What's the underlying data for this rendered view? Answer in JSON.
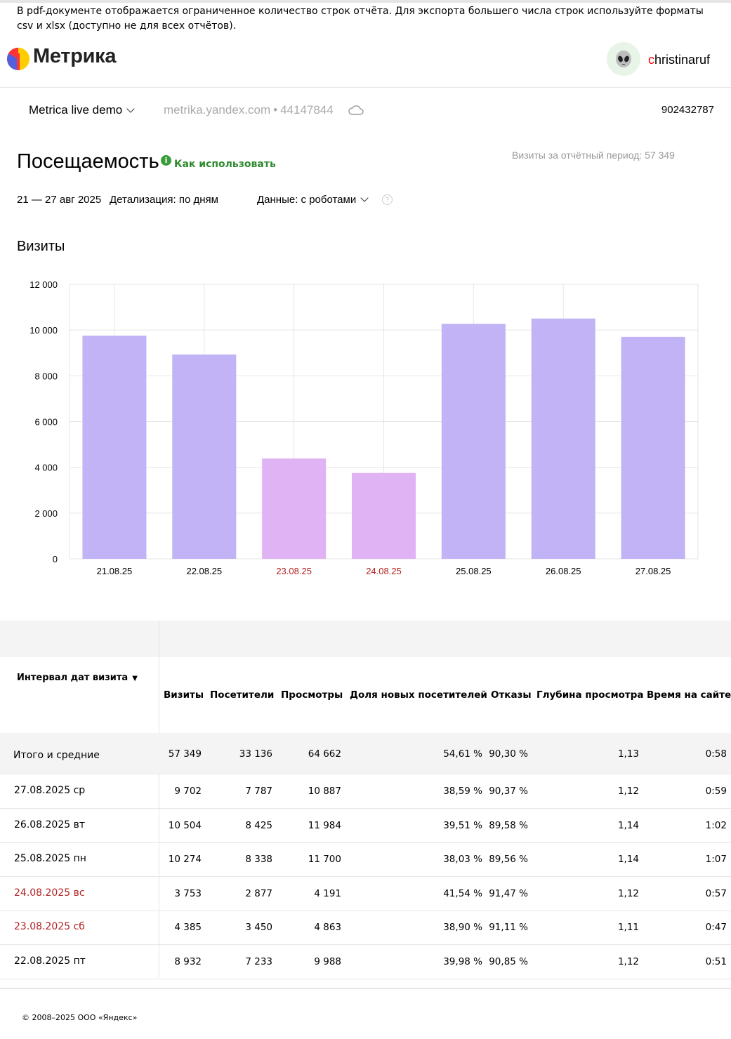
{
  "notice": "В pdf-документе отображается ограниченное количество строк отчёта. Для экспорта большего числа строк используйте форматы csv и xlsx (доступно не для всех отчётов).",
  "header": {
    "logo_text": "Метрика",
    "username_first": "c",
    "username_rest": "hristinaruf",
    "avatar_icon": "alien-icon"
  },
  "counter": {
    "name": "Metrica live demo",
    "site": "metrika.yandex.com",
    "separator": "•",
    "id": "44147844",
    "user_id": "902432787"
  },
  "report": {
    "title": "Посещаемость",
    "howto": "Как использовать",
    "visits_total": "Визиты за отчётный период: 57 349",
    "date_range": "21 — 27 авг 2025",
    "detail": "Детализация: по дням",
    "robots": "Данные: с роботами",
    "help_mark": "?"
  },
  "colors": {
    "weekday_bar": "#c1b3f5",
    "weekend_bar": "#e0b3f5",
    "weekend_text": "#b22222",
    "grid": "#e6e6e6"
  },
  "chart_data": {
    "type": "bar",
    "title": "Визиты",
    "categories": [
      "21.08.25",
      "22.08.25",
      "23.08.25",
      "24.08.25",
      "25.08.25",
      "26.08.25",
      "27.08.25"
    ],
    "values": [
      9754,
      8932,
      4385,
      3753,
      10274,
      10504,
      9702
    ],
    "weekend": [
      false,
      false,
      true,
      true,
      false,
      false,
      false
    ],
    "ylim": [
      0,
      12000
    ],
    "yticks": [
      "0",
      "2 000",
      "4 000",
      "6 000",
      "8 000",
      "10 000",
      "12 000"
    ],
    "grid": true
  },
  "table": {
    "dim_header": "Интервал дат визита",
    "sort_mark": "▼",
    "columns": [
      "Визиты",
      "Посетители",
      "Просмотры",
      "Доля новых посетителей",
      "Отказы",
      "Глубина просмотра",
      "Время на сайте"
    ],
    "total": {
      "label": "Итого и средние",
      "values": [
        "57 349",
        "33 136",
        "64 662",
        "54,61 %",
        "90,30 %",
        "1,13",
        "0:58"
      ]
    },
    "rows": [
      {
        "label": "27.08.2025 ср",
        "weekend": false,
        "values": [
          "9 702",
          "7 787",
          "10 887",
          "38,59 %",
          "90,37 %",
          "1,12",
          "0:59"
        ]
      },
      {
        "label": "26.08.2025 вт",
        "weekend": false,
        "values": [
          "10 504",
          "8 425",
          "11 984",
          "39,51 %",
          "89,58 %",
          "1,14",
          "1:02"
        ]
      },
      {
        "label": "25.08.2025 пн",
        "weekend": false,
        "values": [
          "10 274",
          "8 338",
          "11 700",
          "38,03 %",
          "89,56 %",
          "1,14",
          "1:07"
        ]
      },
      {
        "label": "24.08.2025 вс",
        "weekend": true,
        "values": [
          "3 753",
          "2 877",
          "4 191",
          "41,54 %",
          "91,47 %",
          "1,12",
          "0:57"
        ]
      },
      {
        "label": "23.08.2025 сб",
        "weekend": true,
        "values": [
          "4 385",
          "3 450",
          "4 863",
          "38,90 %",
          "91,11 %",
          "1,11",
          "0:47"
        ]
      },
      {
        "label": "22.08.2025 пт",
        "weekend": false,
        "values": [
          "8 932",
          "7 233",
          "9 988",
          "39,98 %",
          "90,85 %",
          "1,12",
          "0:51"
        ]
      }
    ]
  },
  "footer": {
    "copyright": "© 2008–2025 ООО «Яндекс»"
  }
}
